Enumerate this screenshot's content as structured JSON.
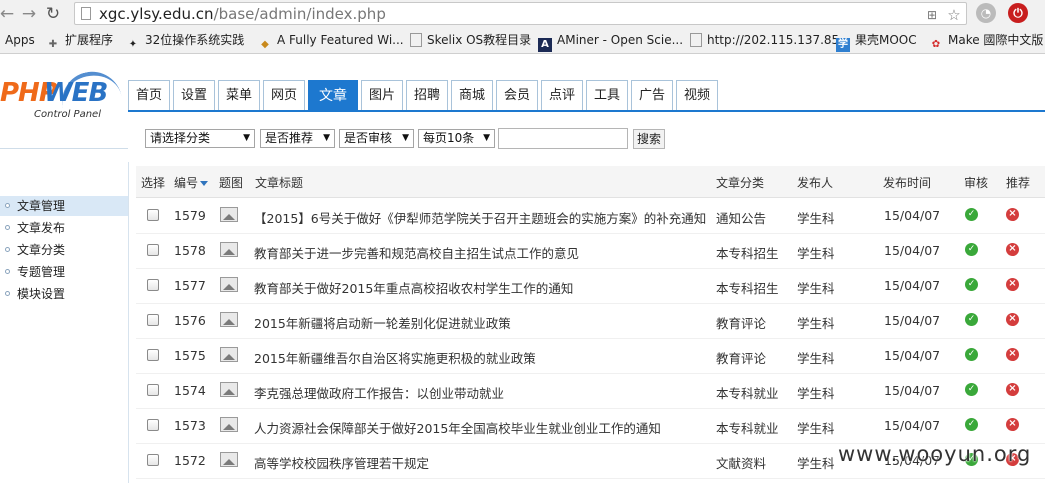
{
  "browser": {
    "url_host": "xgc.ylsy.edu.cn",
    "url_path": "/base/admin/index.php",
    "bookmarks": [
      {
        "icon": "apps-grid-icon",
        "label": "Apps"
      },
      {
        "icon": "puzzle-icon",
        "label": "扩展程序"
      },
      {
        "icon": "tux-icon",
        "label": "32位操作系统实践"
      },
      {
        "icon": "shield-icon",
        "label": "A Fully Featured Wi..."
      },
      {
        "icon": "page-icon",
        "label": "Skelix OS教程目录"
      },
      {
        "icon": "aminer-icon",
        "label": "AMiner - Open Scie..."
      },
      {
        "icon": "page-icon",
        "label": "http://202.115.137.85"
      },
      {
        "icon": "mooc-icon",
        "label": "果壳MOOC"
      },
      {
        "icon": "make-icon",
        "label": "Make 國際中文版"
      }
    ],
    "mooc_badge": "学"
  },
  "logo": {
    "part1": "PHP",
    "part2": "WEB",
    "subtitle": "Control Panel"
  },
  "tabs": [
    "首页",
    "设置",
    "菜单",
    "网页",
    "文章",
    "图片",
    "招聘",
    "商城",
    "会员",
    "点评",
    "工具",
    "广告",
    "视频"
  ],
  "active_tab": "文章",
  "sidebar": {
    "items": [
      "文章管理",
      "文章发布",
      "文章分类",
      "专题管理",
      "模块设置"
    ],
    "active": "文章管理"
  },
  "filters": {
    "category": "请选择分类",
    "recommend": "是否推荐",
    "review": "是否审核",
    "per_page": "每页10条",
    "keyword": "",
    "search_label": "搜索"
  },
  "table": {
    "headers": [
      "选择",
      "编号",
      "题图",
      "文章标题",
      "文章分类",
      "发布人",
      "发布时间",
      "审核",
      "推荐"
    ],
    "rows": [
      {
        "id": "1579",
        "title": "【2015】6号关于做好《伊犁师范学院关于召开主题班会的实施方案》的补充通知",
        "category": "通知公告",
        "author": "学生科",
        "date": "15/04/07"
      },
      {
        "id": "1578",
        "title": "教育部关于进一步完善和规范高校自主招生试点工作的意见",
        "category": "本专科招生",
        "author": "学生科",
        "date": "15/04/07"
      },
      {
        "id": "1577",
        "title": "教育部关于做好2015年重点高校招收农村学生工作的通知",
        "category": "本专科招生",
        "author": "学生科",
        "date": "15/04/07"
      },
      {
        "id": "1576",
        "title": "2015年新疆将启动新一轮差别化促进就业政策",
        "category": "教育评论",
        "author": "学生科",
        "date": "15/04/07"
      },
      {
        "id": "1575",
        "title": "2015年新疆维吾尔自治区将实施更积极的就业政策",
        "category": "教育评论",
        "author": "学生科",
        "date": "15/04/07"
      },
      {
        "id": "1574",
        "title": "李克强总理做政府工作报告：以创业带动就业",
        "category": "本专科就业",
        "author": "学生科",
        "date": "15/04/07"
      },
      {
        "id": "1573",
        "title": "人力资源社会保障部关于做好2015年全国高校毕业生就业创业工作的通知",
        "category": "本专科就业",
        "author": "学生科",
        "date": "15/04/07"
      },
      {
        "id": "1572",
        "title": "高等学校校园秩序管理若干规定",
        "category": "文献资料",
        "author": "学生科",
        "date": "15/04/07"
      }
    ]
  },
  "watermark": "www.wooyun.org",
  "colors": {
    "accent": "#1d78cf",
    "ok": "#3aa83a",
    "no": "#d43d3d"
  }
}
